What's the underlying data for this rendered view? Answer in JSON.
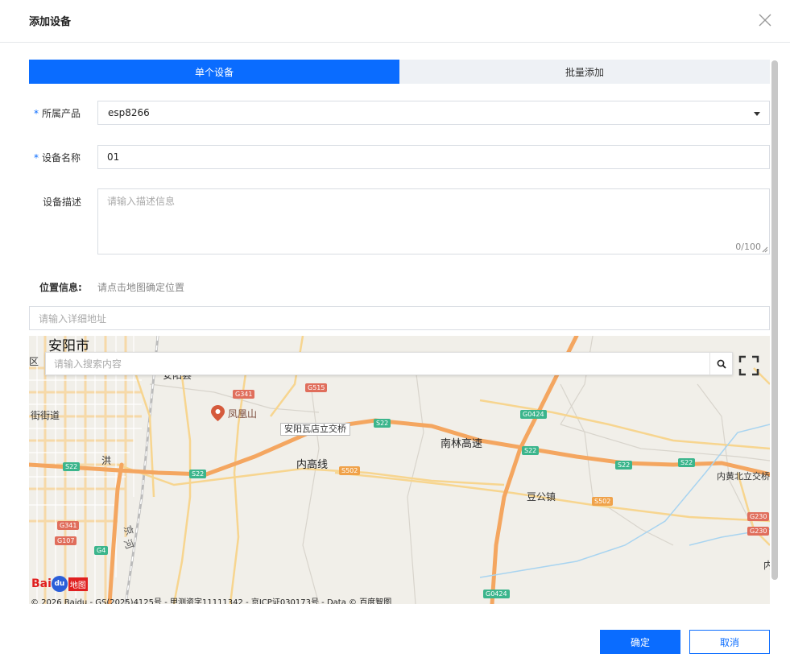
{
  "dialog": {
    "title": "添加设备",
    "colors": {
      "primary": "#0a6cff",
      "tab_inactive_bg": "#eef1f5"
    }
  },
  "tabs": [
    {
      "label": "单个设备",
      "active": true
    },
    {
      "label": "批量添加",
      "active": false
    }
  ],
  "form": {
    "product": {
      "required_mark": "*",
      "label": "所属产品",
      "value": "esp8266"
    },
    "device_name": {
      "required_mark": "*",
      "label": "设备名称",
      "value": "01"
    },
    "description": {
      "label": "设备描述",
      "placeholder": "请输入描述信息",
      "counter": "0/100"
    },
    "location": {
      "label": "位置信息:",
      "hint": "请点击地图确定位置"
    },
    "address": {
      "placeholder": "请输入详细地址"
    }
  },
  "map": {
    "search_placeholder": "请输入搜索内容",
    "labels": {
      "city": "安阳市",
      "qu": "区",
      "anyangxian": "安阳县",
      "fenghuangshan": "凤凰山",
      "jiedao": "街街道",
      "hong": "洪",
      "he": "河",
      "waqu": "安阳瓦店立交桥",
      "nanlin": "南林高速",
      "neigaoxian": "内高线",
      "dougong": "豆公镇",
      "neihuang": "内黄北立交桥",
      "nei": "内",
      "jing": "京",
      "he2": "河"
    },
    "shields": {
      "g341a": "G341",
      "g515": "G515",
      "s22a": "S22",
      "s22b": "S22",
      "s22c": "S22",
      "s22d": "S22",
      "s22e": "S22",
      "s22f": "S22",
      "g0424a": "G0424",
      "g0424b": "G0424",
      "s502a": "S502",
      "s502b": "S502",
      "g341b": "G341",
      "g107": "G107",
      "g4a": "G4",
      "g4b": "G4",
      "g230a": "G230",
      "g230b": "G230"
    },
    "logo_text": "Bai",
    "logo_paw": "du",
    "logo_ditu": "地图",
    "copyright": "© 2026 Baidu - GS(2025)4125号 - 甲测资字11111342 - 京ICP证030173号 - Data © 百度智图"
  },
  "footer": {
    "ok_label": "确定",
    "cancel_label": "取消"
  }
}
